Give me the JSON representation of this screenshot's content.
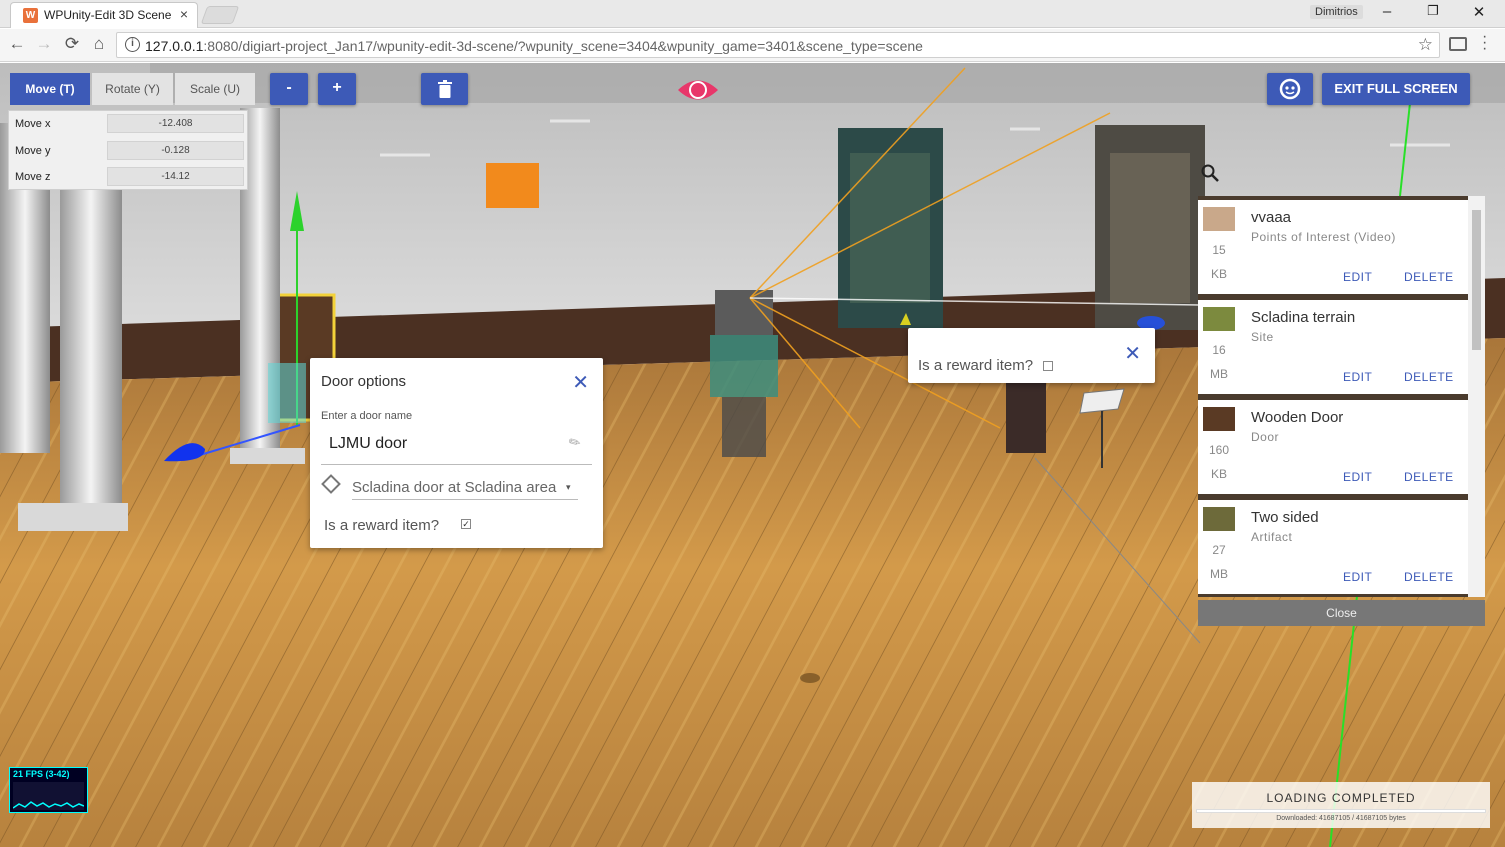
{
  "browser": {
    "tab_title": "WPUnity-Edit 3D Scene",
    "tab_close": "×",
    "user_name": "Dimitrios",
    "window_controls": {
      "minimize": "–",
      "restore": "❐",
      "close": "✕"
    },
    "nav": {
      "back": "←",
      "forward": "→",
      "reload": "⟳",
      "home": "⌂"
    },
    "url_host": "127.0.0.1",
    "url_path": ":8080/digiart-project_Jan17/wpunity-edit-3d-scene/?wpunity_scene=3404&wpunity_game=3401&scene_type=scene",
    "bookmark_icon": "☆"
  },
  "editor": {
    "modes": [
      {
        "label": "Move (T)",
        "active": true
      },
      {
        "label": "Rotate (Y)",
        "active": false
      },
      {
        "label": "Scale (U)",
        "active": false
      }
    ],
    "zoom_out_label": "-",
    "zoom_in_label": "+",
    "delete_icon": "trash-icon",
    "eye_icon": "eye-icon",
    "avatar_icon": "avatar-view-icon",
    "exit_fullscreen_label": "EXIT FULL SCREEN",
    "move_fields": [
      {
        "label": "Move x",
        "value": "-12.408"
      },
      {
        "label": "Move y",
        "value": "-0.128"
      },
      {
        "label": "Move z",
        "value": "-14.12"
      }
    ],
    "search_icon": "search-icon"
  },
  "door_dialog": {
    "title": "Door options",
    "close_icon": "✕",
    "name_label": "Enter a door name",
    "name_value": "LJMU door",
    "target_value": "Scladina door at Scladina area",
    "target_caret": "▾",
    "reward_label": "Is a reward item?",
    "reward_checked": true
  },
  "reward_dialog": {
    "label": "Is a reward item?",
    "checked": false,
    "close_icon": "✕"
  },
  "assets": [
    {
      "name": "vvaaa",
      "type": "Points of Interest (Video)",
      "size_num": "15",
      "size_unit": "KB",
      "thumb_color": "#c9a88a",
      "edit": "EDIT",
      "delete": "DELETE"
    },
    {
      "name": "Scladina terrain",
      "type": "Site",
      "size_num": "16",
      "size_unit": "MB",
      "thumb_color": "#7c8a3e",
      "edit": "EDIT",
      "delete": "DELETE"
    },
    {
      "name": "Wooden Door",
      "type": "Door",
      "size_num": "160",
      "size_unit": "KB",
      "thumb_color": "#5a3a24",
      "edit": "EDIT",
      "delete": "DELETE"
    },
    {
      "name": "Two sided",
      "type": "Artifact",
      "size_num": "27",
      "size_unit": "MB",
      "thumb_color": "#6d6a3a",
      "edit": "EDIT",
      "delete": "DELETE"
    }
  ],
  "asset_close_label": "Close",
  "loading": {
    "text": "LOADING COMPLETED",
    "bytes": "Downloaded: 41687105 / 41687105 bytes",
    "progress": 1.0
  },
  "stats": {
    "fps": "21 FPS (3-42)"
  },
  "colors": {
    "accent": "#3d5ab7",
    "eye": "#e8376a",
    "floor": "#c68a3c",
    "wall": "#cfcfcf"
  }
}
